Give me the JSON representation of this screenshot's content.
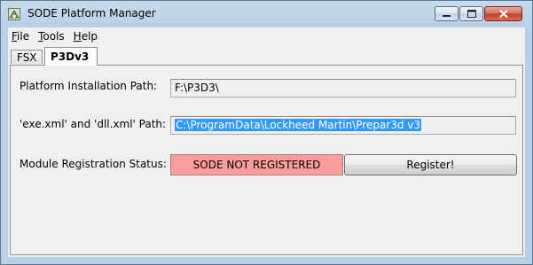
{
  "window": {
    "title": "SODE Platform Manager"
  },
  "menu": {
    "items": [
      {
        "label_first": "F",
        "label_rest": "ile"
      },
      {
        "label_first": "T",
        "label_rest": "ools"
      },
      {
        "label_first": "H",
        "label_rest": "elp"
      }
    ]
  },
  "tabs": [
    {
      "label": "FSX",
      "active": false
    },
    {
      "label": "P3Dv3",
      "active": true
    }
  ],
  "form": {
    "install_path": {
      "label": "Platform Installation Path:",
      "value": "F:\\P3D3\\"
    },
    "xml_path": {
      "label": "'exe.xml' and 'dll.xml' Path:",
      "value": "C:\\ProgramData\\Lockheed Martin\\Prepar3d v3"
    },
    "registration": {
      "label": "Module Registration Status:",
      "status": "SODE NOT REGISTERED",
      "status_color": "#ff9b9b",
      "button_label": "Register!"
    }
  },
  "icons": {
    "app": "sode-app-icon",
    "minimize": "minimize-icon",
    "maximize": "maximize-icon",
    "close": "close-icon"
  }
}
